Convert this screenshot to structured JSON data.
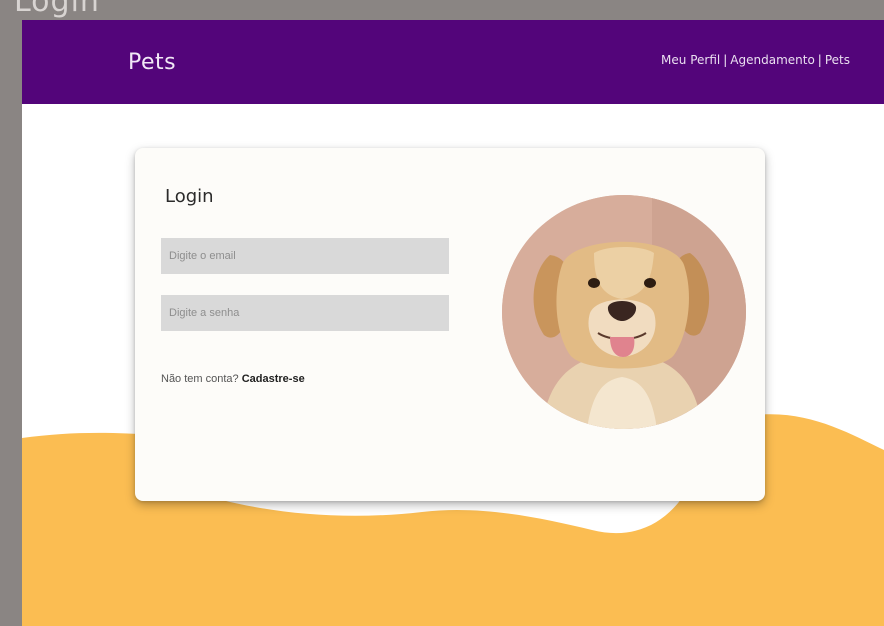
{
  "window": {
    "title": "Login"
  },
  "navbar": {
    "brand": "Pets",
    "links": [
      "Meu Perfil",
      "Agendamento",
      "Pets"
    ],
    "background": "#53057a"
  },
  "login": {
    "title": "Login",
    "email_placeholder": "Digite o email",
    "password_placeholder": "Digite a senha",
    "signup_prompt": "Não tem conta?",
    "signup_link": "Cadastre-se"
  },
  "photo": {
    "subject": "dog-photo"
  },
  "colors": {
    "accent_wave": "#fbbd52",
    "card": "#fdfcf9",
    "field": "#d9d9d9"
  }
}
